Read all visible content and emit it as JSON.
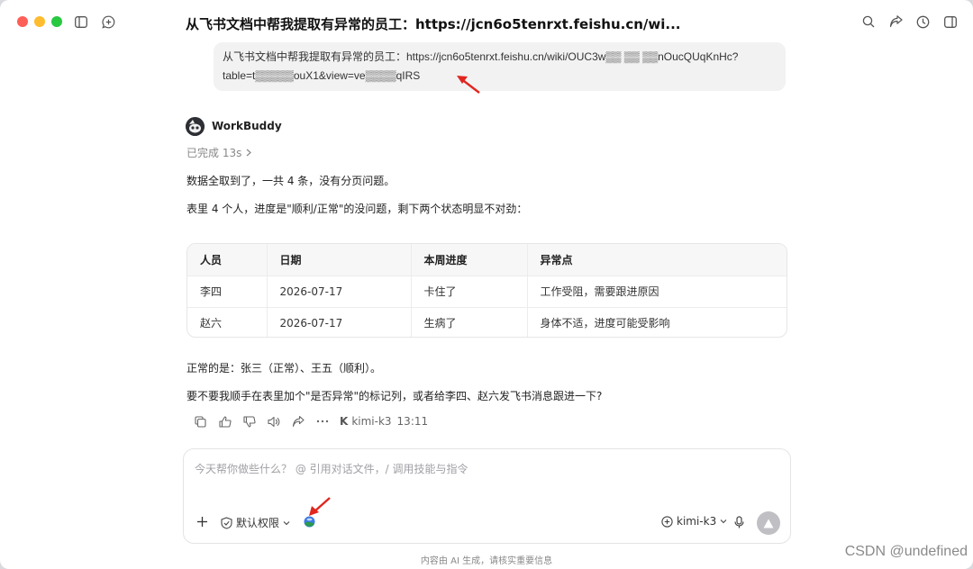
{
  "window": {
    "title": "从飞书文档中帮我提取有异常的员工：https://jcn6o5tenrxt.feishu.cn/wi..."
  },
  "user_message": {
    "line1": "从飞书文档中帮我提取有异常的员工：https://jcn6o5tenrxt.feishu.cn/wiki/OUC3w▒▒ ▒▒ ▒▒nOucQUqKnHc?",
    "line2": "table=t▒▒▒▒▒ouX1&view=ve▒▒▒▒qIRS"
  },
  "assistant": {
    "name": "WorkBuddy",
    "status": "已完成 13s",
    "intro1": "数据全取到了，一共 4 条，没有分页问题。",
    "intro2": "表里 4 个人，进度是\"顺利/正常\"的没问题，剩下两个状态明显不对劲：",
    "table": {
      "headers": [
        "人员",
        "日期",
        "本周进度",
        "异常点"
      ],
      "rows": [
        [
          "李四",
          "2026-07-17",
          "卡住了",
          "工作受阻，需要跟进原因"
        ],
        [
          "赵六",
          "2026-07-17",
          "生病了",
          "身体不适，进度可能受影响"
        ]
      ]
    },
    "normal_line": "正常的是：张三（正常）、王五（顺利）。",
    "question": "要不要我顺手在表里加个\"是否异常\"的标记列，或者给李四、赵六发飞书消息跟进一下?",
    "model_label": "kimi-k3",
    "time": "13:11"
  },
  "input": {
    "placeholder": "今天帮你做些什么？ @ 引用对话文件，/ 调用技能与指令",
    "permission_label": "默认权限",
    "model_select": "kimi-k3"
  },
  "footer": {
    "note": "内容由 AI 生成，请核实重要信息"
  },
  "watermark": "CSDN @undefined",
  "icons": [
    "sidebar-icon",
    "new-chat-icon",
    "search-icon",
    "share-icon",
    "history-icon",
    "panel-icon",
    "copy-icon",
    "thumbs-up-icon",
    "thumbs-down-icon",
    "speaker-icon",
    "forward-icon",
    "more-icon",
    "plus-icon",
    "shield-check-icon",
    "globe-icon",
    "microphone-icon",
    "send-icon"
  ],
  "colors": {
    "accent_red": "#e0261f",
    "send_disabled": "#bfbfc4"
  }
}
